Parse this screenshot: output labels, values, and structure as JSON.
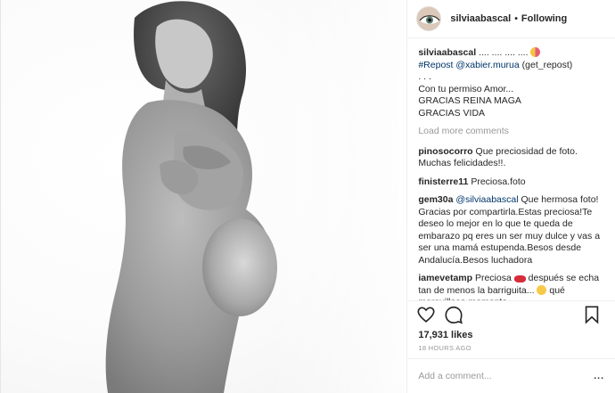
{
  "header": {
    "username": "silviaabascal",
    "separator": "•",
    "follow_status": "Following"
  },
  "caption": {
    "username": "silviaabascal",
    "text": ".... .... .... ....",
    "repost_tag": "#Repost",
    "repost_user": "@xabier.murua",
    "repost_suffix": "(get_repost)",
    "line_dots": ". . .",
    "line1": "Con tu permiso Amor...",
    "line2": "GRACIAS REINA MAGA",
    "line3": "GRACIAS VIDA"
  },
  "load_more": "Load more comments",
  "comments": [
    {
      "user": "pinosocorro",
      "mention": "",
      "text": "Que preciosidad de foto. Muchas felicidades!!."
    },
    {
      "user": "finisterre11",
      "mention": "",
      "text": "Preciosa.foto"
    },
    {
      "user": "gem30a",
      "mention": "@silviaabascal",
      "text": "Que hermosa foto! Gracias por compartirla.Estas preciosa!Te deseo lo mejor en lo que te queda de embarazo pq eres un ser muy dulce y vas a ser una mamá estupenda.Besos desde Andalucía.Besos luchadora"
    },
    {
      "user": "iamevetamp",
      "mention": "",
      "text_a": "Preciosa",
      "text_b": "después se echa tan de menos la barriguita...",
      "text_c": "qué maravilloso momento"
    }
  ],
  "likes": "17,931 likes",
  "timestamp": "18 HOURS AGO",
  "add_comment_placeholder": "Add a comment...",
  "more_options": "...",
  "colors": {
    "link": "#003569",
    "muted": "#999999",
    "text": "#262626",
    "border": "#efefef"
  },
  "icons": [
    "heart-icon",
    "comment-icon",
    "bookmark-icon"
  ]
}
